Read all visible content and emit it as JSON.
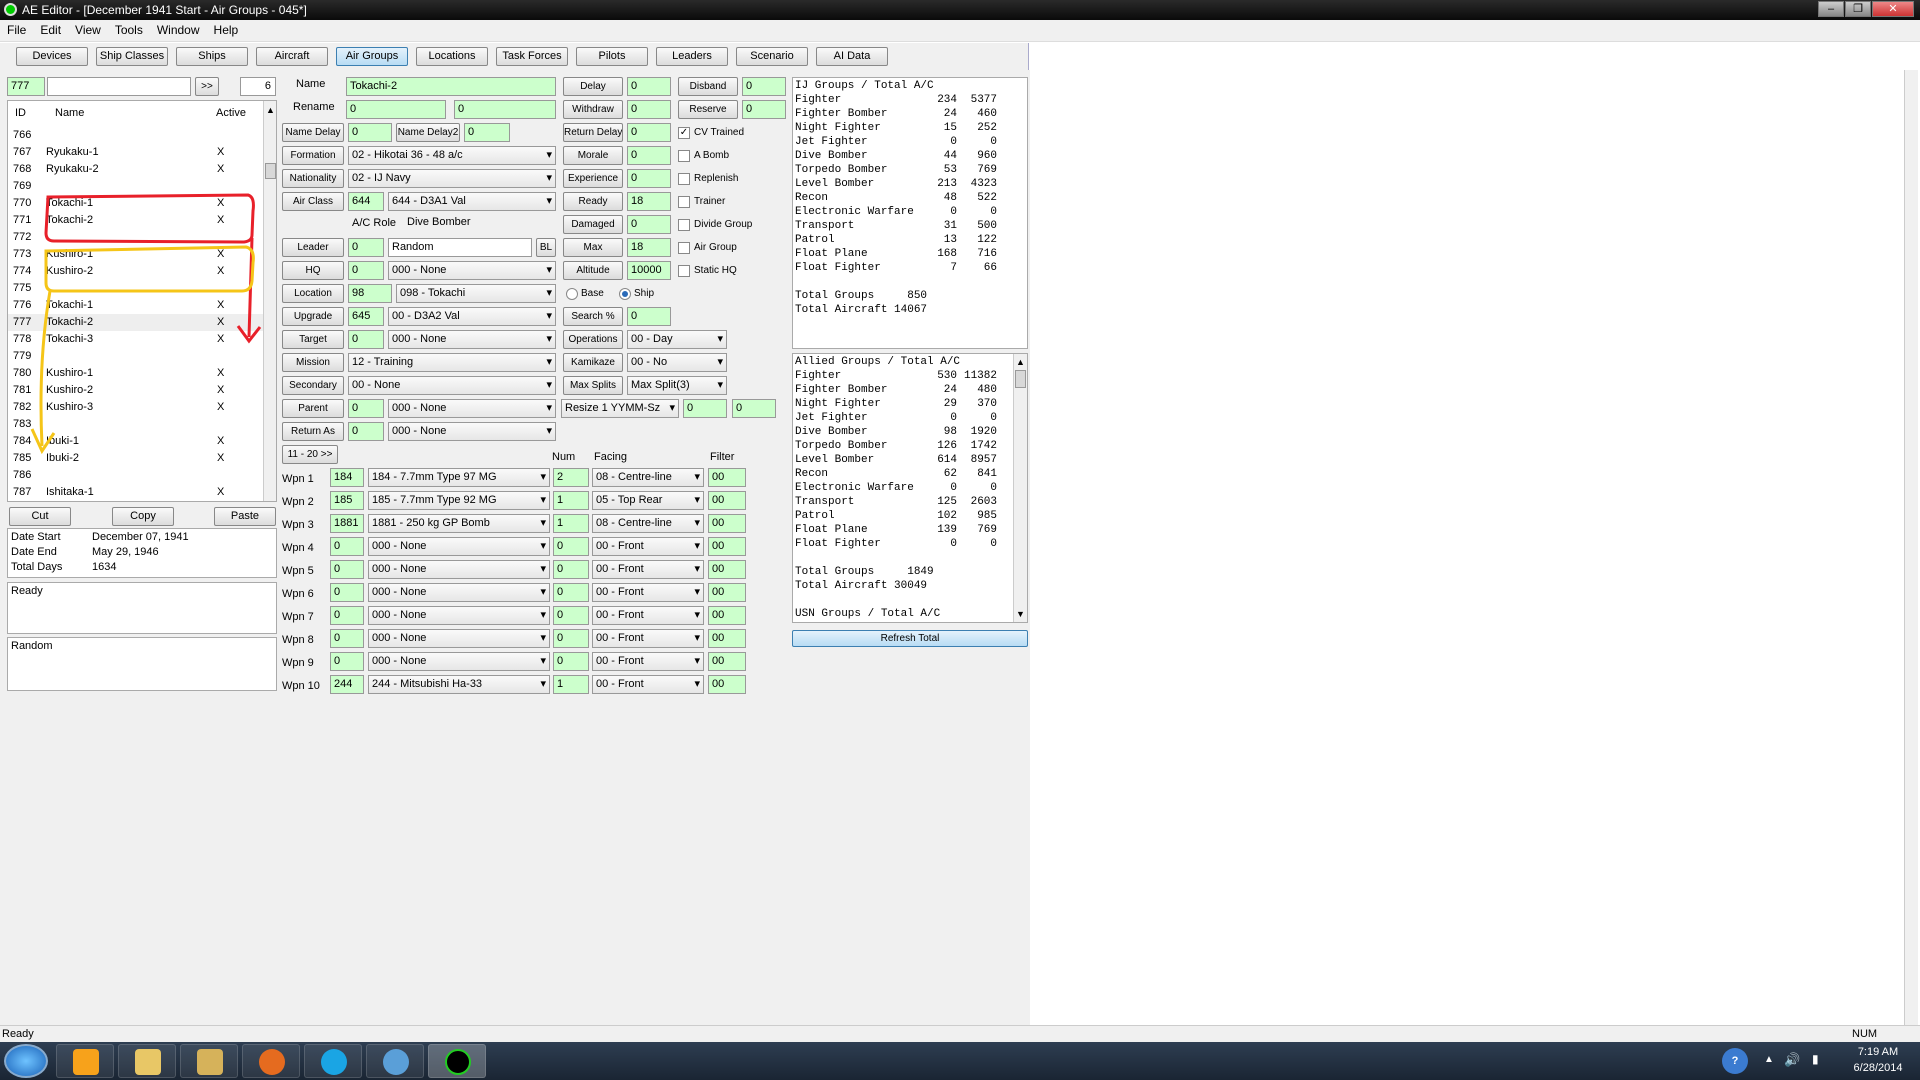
{
  "window": {
    "title": "AE Editor - [December 1941 Start - Air Groups - 045*]"
  },
  "menu": [
    "File",
    "Edit",
    "View",
    "Tools",
    "Window",
    "Help"
  ],
  "nav": [
    "Devices",
    "Ship Classes",
    "Ships",
    "Aircraft",
    "Air Groups",
    "Locations",
    "Task Forces",
    "Pilots",
    "Leaders",
    "Scenario",
    "AI Data"
  ],
  "nav_active": "Air Groups",
  "search": {
    "id": "777",
    "text": "",
    "go": ">>",
    "count": "6"
  },
  "list": {
    "headers": {
      "id": "ID",
      "name": "Name",
      "active": "Active"
    },
    "rows": [
      {
        "id": "766",
        "name": "",
        "active": ""
      },
      {
        "id": "767",
        "name": "Ryukaku-1",
        "active": "X"
      },
      {
        "id": "768",
        "name": "Ryukaku-2",
        "active": "X"
      },
      {
        "id": "769",
        "name": "",
        "active": ""
      },
      {
        "id": "770",
        "name": "Tokachi-1",
        "active": "X"
      },
      {
        "id": "771",
        "name": "Tokachi-2",
        "active": "X"
      },
      {
        "id": "772",
        "name": "",
        "active": ""
      },
      {
        "id": "773",
        "name": "Kushiro-1",
        "active": "X"
      },
      {
        "id": "774",
        "name": "Kushiro-2",
        "active": "X"
      },
      {
        "id": "775",
        "name": "",
        "active": ""
      },
      {
        "id": "776",
        "name": "Tokachi-1",
        "active": "X"
      },
      {
        "id": "777",
        "name": "Tokachi-2",
        "active": "X"
      },
      {
        "id": "778",
        "name": "Tokachi-3",
        "active": "X"
      },
      {
        "id": "779",
        "name": "",
        "active": ""
      },
      {
        "id": "780",
        "name": "Kushiro-1",
        "active": "X"
      },
      {
        "id": "781",
        "name": "Kushiro-2",
        "active": "X"
      },
      {
        "id": "782",
        "name": "Kushiro-3",
        "active": "X"
      },
      {
        "id": "783",
        "name": "",
        "active": ""
      },
      {
        "id": "784",
        "name": "Ibuki-1",
        "active": "X"
      },
      {
        "id": "785",
        "name": "Ibuki-2",
        "active": "X"
      },
      {
        "id": "786",
        "name": "",
        "active": ""
      },
      {
        "id": "787",
        "name": "Ishitaka-1",
        "active": "X"
      }
    ],
    "selected_id": "777"
  },
  "clipboard": {
    "cut": "Cut",
    "copy": "Copy",
    "paste": "Paste"
  },
  "dates": {
    "start_label": "Date Start",
    "start": "December 07, 1941",
    "end_label": "Date End",
    "end": "May 29, 1946",
    "days_label": "Total Days",
    "days": "1634"
  },
  "status_box": "Ready",
  "leader_box": "Random",
  "form": {
    "name_label": "Name",
    "name": "Tokachi-2",
    "rename_label": "Rename",
    "rename1": "0",
    "rename2": "0",
    "name_delay_btn": "Name Delay",
    "name_delay": "0",
    "name_delay2_btn": "Name Delay2",
    "name_delay2": "0",
    "formation_btn": "Formation",
    "formation": "02 - Hikotai 36 - 48 a/c",
    "nationality_btn": "Nationality",
    "nationality": "02 - IJ Navy",
    "air_class_btn": "Air Class",
    "air_class_id": "644",
    "air_class": "644 - D3A1 Val",
    "ac_role_label": "A/C Role",
    "ac_role": "Dive Bomber",
    "leader_btn": "Leader",
    "leader_id": "0",
    "leader": "Random",
    "bl": "BL",
    "hq_btn": "HQ",
    "hq_id": "0",
    "hq": "000 - None",
    "location_btn": "Location",
    "location_id": "98",
    "location": "098 - Tokachi",
    "base_label": "Base",
    "ship_label": "Ship",
    "upgrade_btn": "Upgrade",
    "upgrade_id": "645",
    "upgrade": "00 - D3A2 Val",
    "target_btn": "Target",
    "target_id": "0",
    "target": "000 - None",
    "mission_btn": "Mission",
    "mission": "12 - Training",
    "secondary_btn": "Secondary",
    "secondary": "00 - None",
    "parent_btn": "Parent",
    "parent_id": "0",
    "parent": "000 - None",
    "return_as_btn": "Return As",
    "return_as_id": "0",
    "return_as": "000 - None",
    "delay_btn": "Delay",
    "delay": "0",
    "withdraw_btn": "Withdraw",
    "withdraw": "0",
    "return_delay_btn": "Return Delay",
    "return_delay": "0",
    "morale_btn": "Morale",
    "morale": "0",
    "experience_btn": "Experience",
    "experience": "0",
    "ready_btn": "Ready",
    "ready": "18",
    "damaged_btn": "Damaged",
    "damaged": "0",
    "max_btn": "Max",
    "max": "18",
    "altitude_btn": "Altitude",
    "altitude": "10000",
    "search_btn": "Search %",
    "search": "0",
    "operations_btn": "Operations",
    "operations": "00 - Day",
    "kamikaze_btn": "Kamikaze",
    "kamikaze": "00 - No",
    "max_splits_btn": "Max Splits",
    "max_splits": "Max Split(3)",
    "resize": "Resize 1 YYMM-Sz",
    "resize_a": "0",
    "resize_b": "0",
    "disband_btn": "Disband",
    "disband": "0",
    "reserve_btn": "Reserve",
    "reserve": "0",
    "checks": [
      {
        "label": "CV Trained",
        "checked": true
      },
      {
        "label": "A Bomb",
        "checked": false
      },
      {
        "label": "Replenish",
        "checked": false
      },
      {
        "label": "Trainer",
        "checked": false
      },
      {
        "label": "Divide Group",
        "checked": false
      },
      {
        "label": "Air Group",
        "checked": false
      },
      {
        "label": "Static HQ",
        "checked": false
      }
    ]
  },
  "weapons": {
    "page_btn": "11 - 20 >>",
    "num_label": "Num",
    "facing_label": "Facing",
    "filter_label": "Filter",
    "rows": [
      {
        "label": "Wpn 1",
        "id": "184",
        "name": "184 - 7.7mm Type 97 MG",
        "num": "2",
        "facing": "08 - Centre-line",
        "filter": "00"
      },
      {
        "label": "Wpn 2",
        "id": "185",
        "name": "185 - 7.7mm Type 92 MG",
        "num": "1",
        "facing": "05 - Top Rear",
        "filter": "00"
      },
      {
        "label": "Wpn 3",
        "id": "1881",
        "name": "1881 - 250 kg GP Bomb",
        "num": "1",
        "facing": "08 - Centre-line",
        "filter": "00"
      },
      {
        "label": "Wpn 4",
        "id": "0",
        "name": "000 - None",
        "num": "0",
        "facing": "00 - Front",
        "filter": "00"
      },
      {
        "label": "Wpn 5",
        "id": "0",
        "name": "000 - None",
        "num": "0",
        "facing": "00 - Front",
        "filter": "00"
      },
      {
        "label": "Wpn 6",
        "id": "0",
        "name": "000 - None",
        "num": "0",
        "facing": "00 - Front",
        "filter": "00"
      },
      {
        "label": "Wpn 7",
        "id": "0",
        "name": "000 - None",
        "num": "0",
        "facing": "00 - Front",
        "filter": "00"
      },
      {
        "label": "Wpn 8",
        "id": "0",
        "name": "000 - None",
        "num": "0",
        "facing": "00 - Front",
        "filter": "00"
      },
      {
        "label": "Wpn 9",
        "id": "0",
        "name": "000 - None",
        "num": "0",
        "facing": "00 - Front",
        "filter": "00"
      },
      {
        "label": "Wpn 10",
        "id": "244",
        "name": "244 - Mitsubishi Ha-33",
        "num": "1",
        "facing": "00 - Front",
        "filter": "00"
      }
    ]
  },
  "ij_summary": {
    "header": "IJ Groups / Total A/C",
    "rows": [
      {
        "type": "Fighter",
        "groups": "234",
        "ac": "5377"
      },
      {
        "type": "Fighter Bomber",
        "groups": "24",
        "ac": "460"
      },
      {
        "type": "Night Fighter",
        "groups": "15",
        "ac": "252"
      },
      {
        "type": "Jet Fighter",
        "groups": "0",
        "ac": "0"
      },
      {
        "type": "Dive Bomber",
        "groups": "44",
        "ac": "960"
      },
      {
        "type": "Torpedo Bomber",
        "groups": "53",
        "ac": "769"
      },
      {
        "type": "Level Bomber",
        "groups": "213",
        "ac": "4323"
      },
      {
        "type": "Recon",
        "groups": "48",
        "ac": "522"
      },
      {
        "type": "Electronic Warfare",
        "groups": "0",
        "ac": "0"
      },
      {
        "type": "Transport",
        "groups": "31",
        "ac": "500"
      },
      {
        "type": "Patrol",
        "groups": "13",
        "ac": "122"
      },
      {
        "type": "Float Plane",
        "groups": "168",
        "ac": "716"
      },
      {
        "type": "Float Fighter",
        "groups": "7",
        "ac": "66"
      }
    ],
    "total_groups_label": "Total Groups",
    "total_groups": "850",
    "total_aircraft_label": "Total Aircraft",
    "total_aircraft": "14067"
  },
  "allied_summary": {
    "header": "Allied Groups / Total A/C",
    "rows": [
      {
        "type": "Fighter",
        "groups": "530",
        "ac": "11382"
      },
      {
        "type": "Fighter Bomber",
        "groups": "24",
        "ac": "480"
      },
      {
        "type": "Night Fighter",
        "groups": "29",
        "ac": "370"
      },
      {
        "type": "Jet Fighter",
        "groups": "0",
        "ac": "0"
      },
      {
        "type": "Dive Bomber",
        "groups": "98",
        "ac": "1920"
      },
      {
        "type": "Torpedo Bomber",
        "groups": "126",
        "ac": "1742"
      },
      {
        "type": "Level Bomber",
        "groups": "614",
        "ac": "8957"
      },
      {
        "type": "Recon",
        "groups": "62",
        "ac": "841"
      },
      {
        "type": "Electronic Warfare",
        "groups": "0",
        "ac": "0"
      },
      {
        "type": "Transport",
        "groups": "125",
        "ac": "2603"
      },
      {
        "type": "Patrol",
        "groups": "102",
        "ac": "985"
      },
      {
        "type": "Float Plane",
        "groups": "139",
        "ac": "769"
      },
      {
        "type": "Float Fighter",
        "groups": "0",
        "ac": "0"
      }
    ],
    "total_groups_label": "Total Groups",
    "total_groups": "1849",
    "total_aircraft_label": "Total Aircraft",
    "total_aircraft": "30049",
    "usn_header": "USN Groups / Total A/C"
  },
  "refresh_btn": "Refresh Total",
  "statusbar": {
    "left": "Ready",
    "right": "NUM"
  },
  "tray": {
    "time": "7:19 AM",
    "date": "6/28/2014"
  },
  "colors": {
    "field": "#ccffcc",
    "annotation_red": "#e8202a",
    "annotation_yellow": "#f5c518"
  }
}
